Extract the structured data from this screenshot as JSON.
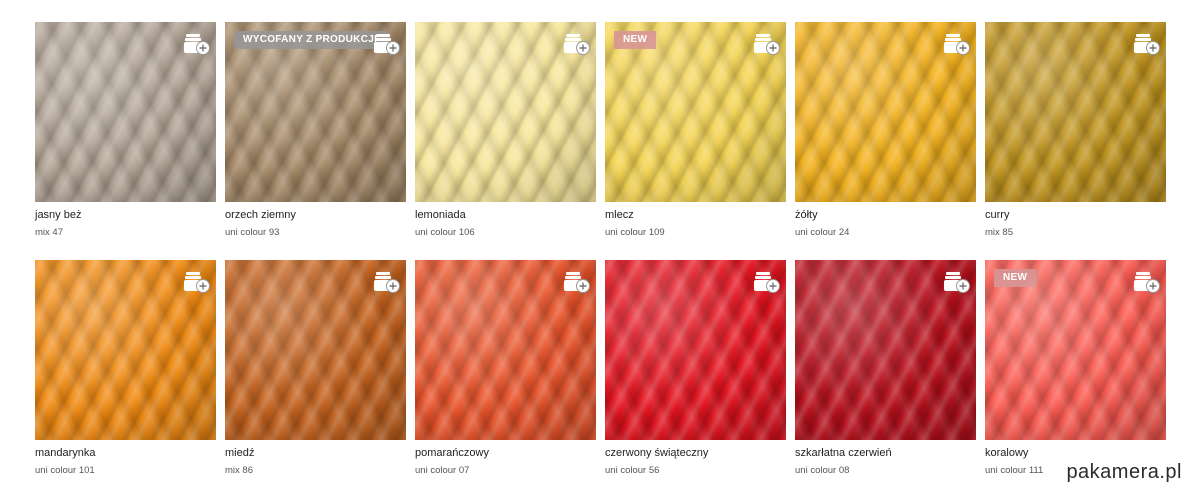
{
  "colors": [
    {
      "name": "jasny beż",
      "code": "mix 47",
      "color": "#b3a597",
      "badge": "",
      "badge_type": ""
    },
    {
      "name": "orzech ziemny",
      "code": "uni colour 93",
      "color": "#a48866",
      "badge": "WYCOFANY Z PRODUKCJI",
      "badge_type": "discontinued"
    },
    {
      "name": "lemoniada",
      "code": "uni colour 106",
      "color": "#f7e69a",
      "badge": "",
      "badge_type": ""
    },
    {
      "name": "mlecz",
      "code": "uni colour 109",
      "color": "#f4d452",
      "badge": "NEW",
      "badge_type": "new"
    },
    {
      "name": "żółty",
      "code": "uni colour 24",
      "color": "#f3b21e",
      "badge": "",
      "badge_type": ""
    },
    {
      "name": "curry",
      "code": "mix 85",
      "color": "#c0941e",
      "badge": "",
      "badge_type": ""
    },
    {
      "name": "mandarynka",
      "code": "uni colour 101",
      "color": "#f08a12",
      "badge": "",
      "badge_type": ""
    },
    {
      "name": "miedź",
      "code": "mix 86",
      "color": "#c4621e",
      "badge": "",
      "badge_type": ""
    },
    {
      "name": "pomarańczowy",
      "code": "uni colour 07",
      "color": "#e8532a",
      "badge": "",
      "badge_type": ""
    },
    {
      "name": "czerwony świąteczny",
      "code": "uni colour 56",
      "color": "#e3131f",
      "badge": "",
      "badge_type": ""
    },
    {
      "name": "szkarłatna czerwień",
      "code": "uni colour 08",
      "color": "#b8101c",
      "badge": "",
      "badge_type": ""
    },
    {
      "name": "koralowy",
      "code": "uni colour 111",
      "color": "#fa5a50",
      "badge": "NEW",
      "badge_type": "new"
    }
  ],
  "watermark": "pakamera.pl"
}
